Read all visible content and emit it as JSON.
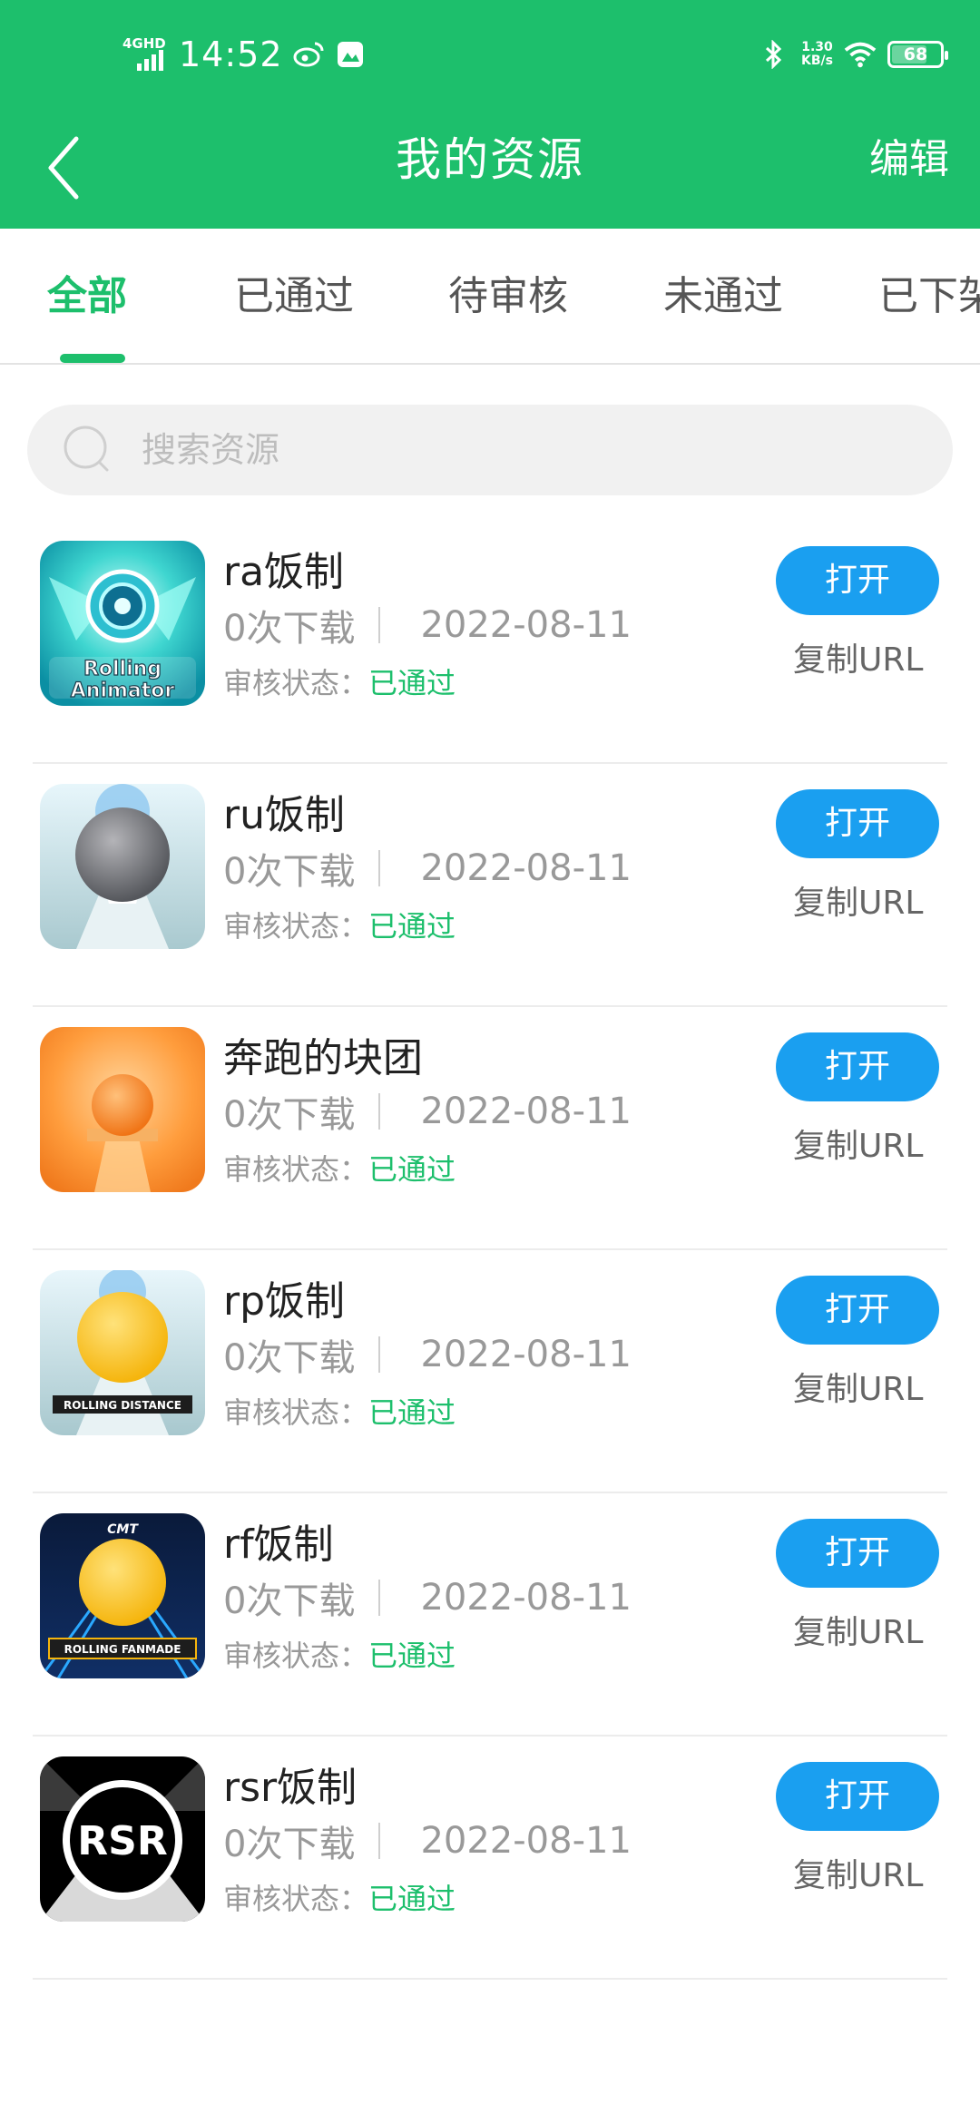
{
  "status_bar": {
    "network": "4GHD",
    "time": "14:52",
    "speed_value": "1.30",
    "speed_unit": "KB/s",
    "battery": "68",
    "icons": [
      "weibo-icon",
      "gallery-icon",
      "bluetooth-icon",
      "wifi-icon",
      "battery-icon"
    ]
  },
  "header": {
    "title": "我的资源",
    "edit_label": "编辑",
    "back_icon": "chevron-left-icon"
  },
  "tabs": [
    {
      "label": "全部",
      "active": true
    },
    {
      "label": "已通过",
      "active": false
    },
    {
      "label": "待审核",
      "active": false
    },
    {
      "label": "未通过",
      "active": false
    },
    {
      "label": "已下架",
      "active": false
    }
  ],
  "search": {
    "placeholder": "搜索资源",
    "value": ""
  },
  "colors": {
    "brand_green": "#1dbf6c",
    "button_blue": "#1a9ff0"
  },
  "items": [
    {
      "name": "ra饭制",
      "downloads": "0次下载",
      "date": "2022-08-11",
      "status_label": "审核状态：",
      "status": "已通过",
      "open_label": "打开",
      "copy_label": "复制URL",
      "thumb_text": "Rolling Animator",
      "thumb_theme": "cyan-blue"
    },
    {
      "name": "ru饭制",
      "downloads": "0次下载",
      "date": "2022-08-11",
      "status_label": "审核状态：",
      "status": "已通过",
      "open_label": "打开",
      "copy_label": "复制URL",
      "thumb_text": "",
      "thumb_theme": "gray-ball"
    },
    {
      "name": "奔跑的块团",
      "downloads": "0次下载",
      "date": "2022-08-11",
      "status_label": "审核状态：",
      "status": "已通过",
      "open_label": "打开",
      "copy_label": "复制URL",
      "thumb_text": "",
      "thumb_theme": "orange"
    },
    {
      "name": "rp饭制",
      "downloads": "0次下载",
      "date": "2022-08-11",
      "status_label": "审核状态：",
      "status": "已通过",
      "open_label": "打开",
      "copy_label": "复制URL",
      "thumb_text": "ROLLING DISTANCE",
      "thumb_theme": "yellow-ball-light"
    },
    {
      "name": "rf饭制",
      "downloads": "0次下载",
      "date": "2022-08-11",
      "status_label": "审核状态：",
      "status": "已通过",
      "open_label": "打开",
      "copy_label": "复制URL",
      "thumb_text": "ROLLING FANMADE",
      "thumb_theme": "yellow-ball-dark"
    },
    {
      "name": "rsr饭制",
      "downloads": "0次下载",
      "date": "2022-08-11",
      "status_label": "审核状态：",
      "status": "已通过",
      "open_label": "打开",
      "copy_label": "复制URL",
      "thumb_text": "RSR",
      "thumb_theme": "black-white"
    }
  ]
}
